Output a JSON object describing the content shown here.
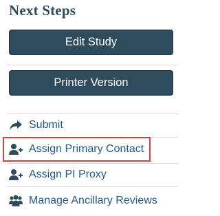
{
  "panel": {
    "title": "Next Steps",
    "buttons": {
      "edit_study": "Edit Study",
      "printer_version": "Printer Version"
    },
    "links": [
      {
        "label": "Submit",
        "icon": "share-arrow-icon"
      },
      {
        "label": "Assign Primary Contact",
        "icon": "user-add-icon"
      },
      {
        "label": "Assign PI Proxy",
        "icon": "user-add-icon"
      },
      {
        "label": "Manage Ancillary Reviews",
        "icon": "users-group-icon"
      }
    ]
  },
  "colors": {
    "button_bg": "#2f4b5e",
    "link_text": "#1e5a8a",
    "highlight_border": "#e03c3c",
    "icon_fill": "#2f4b5e"
  }
}
